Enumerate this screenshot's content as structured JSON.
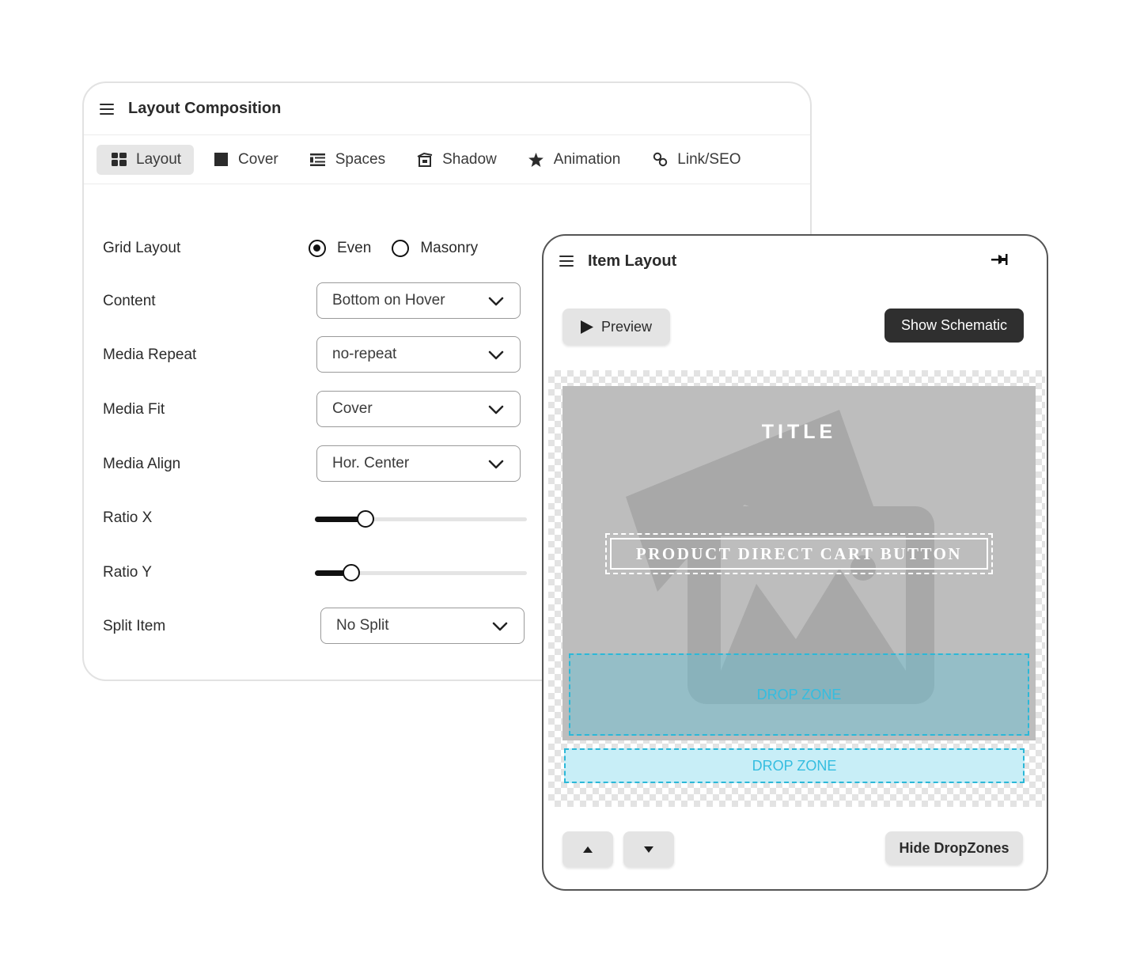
{
  "layout_composition": {
    "title": "Layout Composition",
    "tabs": [
      {
        "label": "Layout",
        "icon": "grid-icon",
        "active": true
      },
      {
        "label": "Cover",
        "icon": "square-icon",
        "active": false
      },
      {
        "label": "Spaces",
        "icon": "list-icon",
        "active": false
      },
      {
        "label": "Shadow",
        "icon": "shadow-icon",
        "active": false
      },
      {
        "label": "Animation",
        "icon": "star-icon",
        "active": false
      },
      {
        "label": "Link/SEO",
        "icon": "link-icon",
        "active": false
      }
    ],
    "fields": {
      "grid_layout": {
        "label": "Grid Layout",
        "options": [
          "Even",
          "Masonry"
        ],
        "selected": "Even"
      },
      "content": {
        "label": "Content",
        "value": "Bottom on Hover"
      },
      "media_repeat": {
        "label": "Media Repeat",
        "value": "no-repeat"
      },
      "media_fit": {
        "label": "Media Fit",
        "value": "Cover"
      },
      "media_align": {
        "label": "Media Align",
        "value": "Hor. Center"
      },
      "ratio_x": {
        "label": "Ratio X",
        "level": 0.24
      },
      "ratio_y": {
        "label": "Ratio Y",
        "level": 0.17
      },
      "split_item": {
        "label": "Split Item",
        "value": "No Split"
      }
    }
  },
  "item_layout": {
    "title": "Item Layout",
    "preview_label": "Preview",
    "show_schematic_label": "Show Schematic",
    "item_title": "TITLE",
    "cart_button_label": "PRODUCT DIRECT CART BUTTON",
    "drop_zone_inner": "DROP ZONE",
    "drop_zone_outer": "DROP ZONE",
    "hide_dropzones_label": "Hide DropZones"
  },
  "colors": {
    "dark_button": "#2f2f2f",
    "drop_zone_border": "#2bb8d8",
    "drop_zone_fill": "#c8eef7",
    "media_background": "#bdbdbd"
  }
}
